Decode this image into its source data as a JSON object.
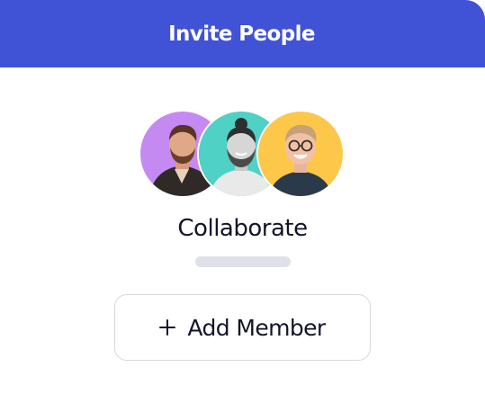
{
  "header": {
    "title": "Invite People",
    "color": "#4052d6"
  },
  "avatars": [
    {
      "name": "avatar-1",
      "bg": "#c58af2"
    },
    {
      "name": "avatar-2",
      "bg": "#4fd1c5"
    },
    {
      "name": "avatar-3",
      "bg": "#fdc84a"
    }
  ],
  "main": {
    "label": "Collaborate"
  },
  "add_button": {
    "icon": "plus-icon",
    "label": "Add Member"
  }
}
